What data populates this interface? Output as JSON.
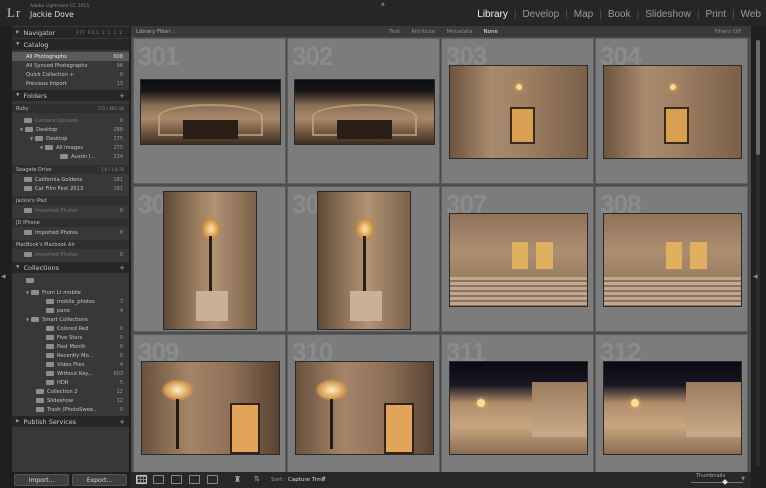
{
  "app": {
    "logo": "Lr",
    "name": "Adobe Lightroom CC 2015",
    "user": "Jackie Dove"
  },
  "modules": [
    {
      "label": "Library",
      "active": true
    },
    {
      "label": "Develop",
      "active": false
    },
    {
      "label": "Map",
      "active": false
    },
    {
      "label": "Book",
      "active": false
    },
    {
      "label": "Slideshow",
      "active": false
    },
    {
      "label": "Print",
      "active": false
    },
    {
      "label": "Web",
      "active": false
    }
  ],
  "left_panel": {
    "navigator": {
      "title": "Navigator",
      "options": "FIT  FILL  1:1  1:2"
    },
    "catalog": {
      "title": "Catalog",
      "items": [
        {
          "label": "All Photographs",
          "count": "608"
        },
        {
          "label": "All Synced Photographs",
          "count": "96"
        },
        {
          "label": "Quick Collection +",
          "count": "0"
        },
        {
          "label": "Previous Import",
          "count": "13"
        }
      ]
    },
    "folders": {
      "title": "Folders",
      "drive1": {
        "name": "Ruby",
        "meter": "172 / 465 GB"
      },
      "items": [
        {
          "label": "Camera Uploads",
          "count": "0"
        },
        {
          "label": "Desktop",
          "count": "288"
        },
        {
          "label": "Desktop",
          "count": "275"
        },
        {
          "label": "All images",
          "count": "275"
        },
        {
          "label": "Austin I...",
          "count": "234"
        }
      ],
      "drive2": {
        "name": "Seagate Drive",
        "meter": "1.6 / 1.8 TB"
      },
      "items2": [
        {
          "label": "California Goldens",
          "count": "181"
        },
        {
          "label": "Cat Film Fest 2013",
          "count": "181"
        }
      ],
      "drive3": {
        "name": "Jackie's iPad"
      },
      "items3": [
        {
          "label": "Imported Photos",
          "count": "0"
        }
      ],
      "drive4": {
        "name": "JD iPhone"
      },
      "items4": [
        {
          "label": "Imported Photos",
          "count": "8"
        }
      ],
      "drive5": {
        "name": "MacBook's Macbook Air"
      },
      "items5": [
        {
          "label": "Imported Photos",
          "count": "0"
        }
      ]
    },
    "collections": {
      "title": "Collections",
      "items": [
        {
          "label": "From Lr mobile",
          "count": ""
        },
        {
          "label": "mobile_photos",
          "count": "7"
        },
        {
          "label": "pano",
          "count": "4"
        },
        {
          "label": "Smart Collections",
          "count": ""
        },
        {
          "label": "Colored Red",
          "count": "0"
        },
        {
          "label": "Five Stars",
          "count": "0"
        },
        {
          "label": "Past Month",
          "count": "0"
        },
        {
          "label": "Recently Mo...",
          "count": "0"
        },
        {
          "label": "Video Files",
          "count": "4"
        },
        {
          "label": "Without Key...",
          "count": "603"
        },
        {
          "label": "HDR",
          "count": "5"
        },
        {
          "label": "Collection 2",
          "count": "12"
        },
        {
          "label": "Slideshow",
          "count": "12"
        },
        {
          "label": "Trash (PhotoSwee...",
          "count": "0"
        }
      ]
    },
    "publish": {
      "title": "Publish Services"
    },
    "import_label": "Import...",
    "export_label": "Export..."
  },
  "library_filter": {
    "label": "Library Filter :",
    "tabs": [
      {
        "label": "Text",
        "on": false
      },
      {
        "label": "Attribute",
        "on": false
      },
      {
        "label": "Metadata",
        "on": false
      },
      {
        "label": "None",
        "on": true
      }
    ],
    "filters_off": "Filters Off"
  },
  "grid": {
    "cells": [
      {
        "num": "301",
        "scene": "facade"
      },
      {
        "num": "302",
        "scene": "facade"
      },
      {
        "num": "303",
        "scene": "lamp-door"
      },
      {
        "num": "304",
        "scene": "lamp-door"
      },
      {
        "num": "305",
        "scene": "lamp-portrait"
      },
      {
        "num": "306",
        "scene": "lamp-portrait"
      },
      {
        "num": "307",
        "scene": "steps"
      },
      {
        "num": "308",
        "scene": "steps"
      },
      {
        "num": "309",
        "scene": "lamp-closeup"
      },
      {
        "num": "310",
        "scene": "lamp-closeup"
      },
      {
        "num": "311",
        "scene": "building-night"
      },
      {
        "num": "312",
        "scene": "building-night"
      }
    ]
  },
  "toolbar": {
    "sort_label": "Sort:",
    "sort_value": "Capture Time",
    "thumbnails_label": "Thumbnails"
  },
  "colors": {
    "selected": "#5a5a5a",
    "panel": "#383838",
    "grid_bg": "#4d4d4d",
    "cell": "#7c7c7c"
  }
}
